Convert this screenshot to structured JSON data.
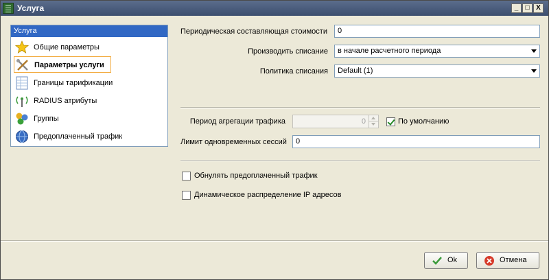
{
  "window": {
    "title": "Услуга"
  },
  "titlebar_buttons": {
    "minimize": "_",
    "maximize": "□",
    "close": "X"
  },
  "sidebar": {
    "header": "Услуга",
    "items": [
      {
        "label": "Общие параметры",
        "icon": "star-icon"
      },
      {
        "label": "Параметры услуги",
        "icon": "tools-icon",
        "selected": true
      },
      {
        "label": "Границы тарификации",
        "icon": "spreadsheet-icon"
      },
      {
        "label": "RADIUS атрибуты",
        "icon": "antenna-icon"
      },
      {
        "label": "Группы",
        "icon": "group-icon"
      },
      {
        "label": "Предоплаченный трафик",
        "icon": "globe-icon"
      }
    ]
  },
  "form": {
    "periodic_cost": {
      "label": "Периодическая составляющая стоимости",
      "value": "0"
    },
    "writeoff_mode": {
      "label": "Производить списание",
      "value": "в начале расчетного периода"
    },
    "writeoff_policy": {
      "label": "Политика списания",
      "value": "Default (1)"
    },
    "aggregation_period": {
      "label": "Период агрегации трафика",
      "value": "0",
      "default_label": "По умолчанию",
      "default_checked": true
    },
    "session_limit": {
      "label": "Лимит одновременных сессий",
      "value": "0"
    },
    "reset_prepaid": {
      "label": "Обнулять предоплаченный трафик",
      "checked": false
    },
    "dynamic_ip": {
      "label": "Динамическое распределение IP адресов",
      "checked": false
    }
  },
  "buttons": {
    "ok": "Ok",
    "cancel": "Отмена"
  },
  "colors": {
    "titlebar": "#3c4e6e",
    "sidebar_header": "#3168c4",
    "selection_border": "#f2a93b",
    "window_bg": "#ece9d8"
  }
}
